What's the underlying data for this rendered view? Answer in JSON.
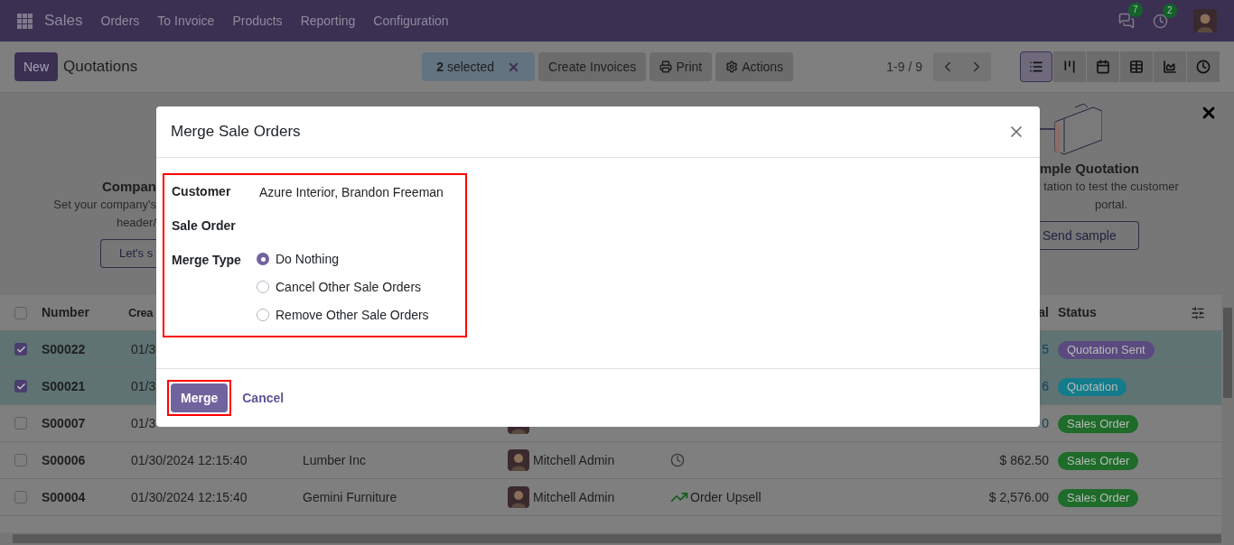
{
  "navbar": {
    "app": "Sales",
    "menu": [
      "Orders",
      "To Invoice",
      "Products",
      "Reporting",
      "Configuration"
    ],
    "messages_badge": "7",
    "activities_badge": "2"
  },
  "control_panel": {
    "new_button": "New",
    "title": "Quotations",
    "selection": "**2** selected",
    "actions": [
      {
        "kind": "plain",
        "label": "Create Invoices"
      },
      {
        "kind": "print",
        "label": "Print"
      },
      {
        "kind": "gear",
        "label": "Actions"
      }
    ],
    "pager": "1-9 / 9",
    "views": [
      {
        "kind": "list",
        "selected": true
      },
      {
        "kind": "kanban",
        "selected": false
      },
      {
        "kind": "calendar",
        "selected": false
      },
      {
        "kind": "pivot",
        "selected": false
      },
      {
        "kind": "graph",
        "selected": false
      },
      {
        "kind": "activity",
        "selected": false
      }
    ]
  },
  "banner": {
    "left": {
      "title": "Compan",
      "lines": [
        "Set your company's",
        "header/"
      ],
      "button": "Let's s"
    },
    "right": {
      "title": "mple Quotation",
      "lines": [
        "tation to test the customer",
        "portal."
      ],
      "button": "Send sample"
    }
  },
  "table": {
    "all_selected": false,
    "columns": [
      "Number",
      "Crea",
      "al",
      "Status"
    ],
    "rows": [
      {
        "selected": true,
        "number": "S00022",
        "created": "01/3",
        "total": "5",
        "status": {
          "label": "Quotation Sent",
          "color": "#5b4a80"
        }
      },
      {
        "selected": true,
        "number": "S00021",
        "created": "01/3",
        "total": "6",
        "status": {
          "label": "Quotation",
          "color": "#137b8a"
        }
      },
      {
        "selected": false,
        "number": "S00007",
        "created": "01/3",
        "avatar": true,
        "total": "0",
        "status": {
          "label": "Sales Order",
          "color": "#1e6b2a"
        }
      },
      {
        "selected": false,
        "number": "S00006",
        "created": "01/30/2024 12:15:40",
        "customer": "Lumber Inc",
        "avatar": true,
        "salesperson": "Mitchell Admin",
        "activity": {
          "kind": "clock"
        },
        "total": "$ 862.50",
        "status": {
          "label": "Sales Order",
          "color": "#1e6b2a"
        }
      },
      {
        "selected": false,
        "number": "S00004",
        "created": "01/30/2024 12:15:40",
        "customer": "Gemini Furniture",
        "avatar": true,
        "salesperson": "Mitchell Admin",
        "activity": {
          "kind": "upsell",
          "label": "Order Upsell"
        },
        "total": "$ 2,576.00",
        "status": {
          "label": "Sales Order",
          "color": "#1e6b2a"
        }
      }
    ]
  },
  "dialog": {
    "title": "Merge Sale Orders",
    "fields": [
      {
        "label": "Customer",
        "value": "Azure Interior, Brandon Freeman"
      },
      {
        "label": "Sale Order"
      }
    ],
    "merge_type": {
      "label": "Merge Type",
      "options": [
        {
          "label": "Do Nothing",
          "selected": true
        },
        {
          "label": "Cancel Other Sale Orders",
          "selected": false
        },
        {
          "label": "Remove Other Sale Orders",
          "selected": false
        }
      ]
    },
    "buttons": [
      "Merge",
      "Cancel"
    ]
  }
}
